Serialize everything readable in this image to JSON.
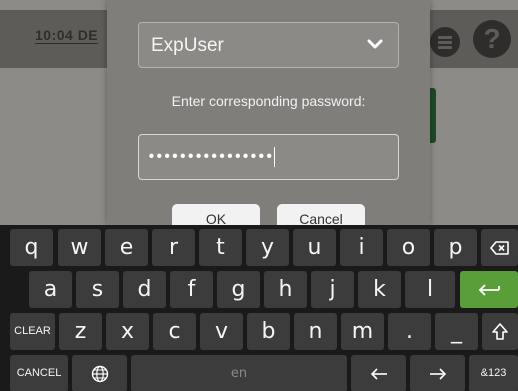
{
  "status": {
    "time": "10:04 DE"
  },
  "dialog": {
    "user": "ExpUser",
    "prompt": "Enter corresponding password:",
    "password_value": "••••••••••••••••",
    "ok_label": "OK",
    "cancel_label": "Cancel"
  },
  "keyboard": {
    "row1": [
      "q",
      "w",
      "e",
      "r",
      "t",
      "y",
      "u",
      "i",
      "o",
      "p"
    ],
    "row2": [
      "a",
      "s",
      "d",
      "f",
      "g",
      "h",
      "j",
      "k",
      "l"
    ],
    "row3": [
      "z",
      "x",
      "c",
      "v",
      "b",
      "n",
      "m",
      ".",
      "_"
    ],
    "clear_label": "CLEAR",
    "cancel_label": "CANCEL",
    "space_label": "en",
    "symbols_label": "&123",
    "accent_color": "#5a9e3a"
  }
}
